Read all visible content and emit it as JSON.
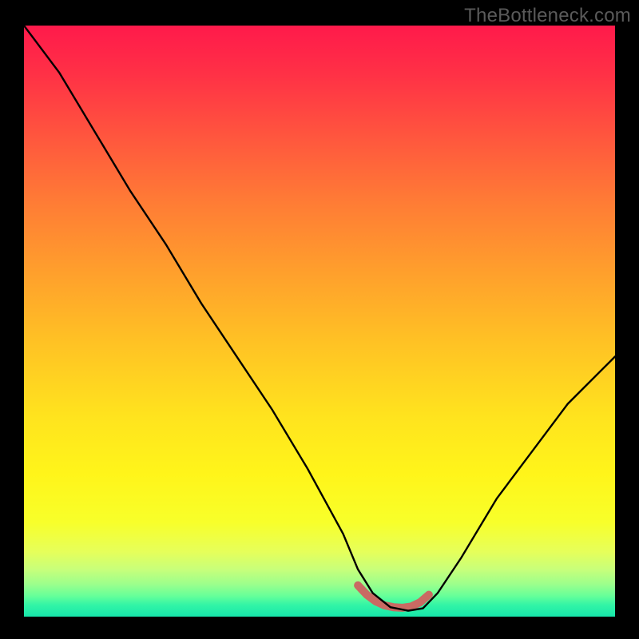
{
  "watermark": "TheBottleneck.com",
  "chart_data": {
    "type": "line",
    "title": "",
    "xlabel": "",
    "ylabel": "",
    "xlim": [
      0,
      100
    ],
    "ylim": [
      0,
      100
    ],
    "grid": false,
    "legend": false,
    "notes": "V-shaped bottleneck curve over red-to-green vertical gradient. Lower values = better (green band near bottom). Flat minimum region highlighted by short thick salmon segment.",
    "series": [
      {
        "name": "bottleneck-curve",
        "color": "#000000",
        "x": [
          0,
          6,
          12,
          18,
          24,
          30,
          36,
          42,
          48,
          54,
          56.5,
          59,
          62,
          65,
          67.5,
          70,
          74,
          80,
          86,
          92,
          98,
          100
        ],
        "values": [
          100,
          92,
          82,
          72,
          63,
          53,
          44,
          35,
          25,
          14,
          8,
          4,
          1.6,
          1,
          1.4,
          4,
          10,
          20,
          28,
          36,
          42,
          44
        ]
      },
      {
        "name": "optimal-range-marker",
        "color": "#c96a63",
        "x": [
          56.5,
          58,
          59.5,
          61,
          62.5,
          64,
          65.5,
          67,
          68.5
        ],
        "values": [
          5.3,
          3.7,
          2.6,
          1.9,
          1.6,
          1.5,
          1.7,
          2.4,
          3.7
        ]
      }
    ],
    "gradient_stops": [
      {
        "pos": 0,
        "color": "#ff1a4b"
      },
      {
        "pos": 0.3,
        "color": "#ff7c35"
      },
      {
        "pos": 0.6,
        "color": "#ffd820"
      },
      {
        "pos": 0.85,
        "color": "#f2ff40"
      },
      {
        "pos": 0.96,
        "color": "#7dff90"
      },
      {
        "pos": 1.0,
        "color": "#16e6aa"
      }
    ]
  }
}
